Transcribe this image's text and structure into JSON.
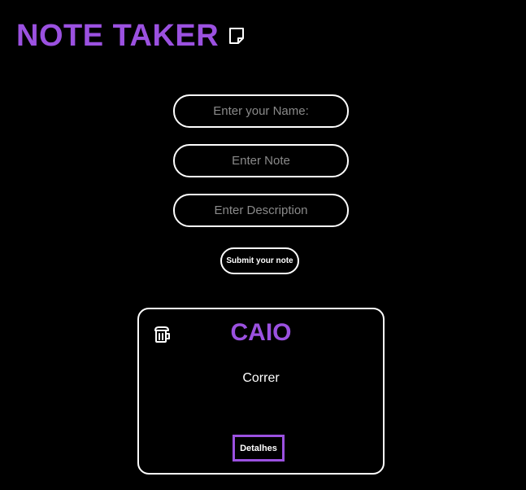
{
  "header": {
    "title": "NOTE TAKER",
    "icon": "note-icon"
  },
  "form": {
    "name_placeholder": "Enter your Name:",
    "note_placeholder": "Enter Note",
    "description_placeholder": "Enter Description",
    "submit_label": "Submit your note"
  },
  "notes": [
    {
      "name": "CAIO",
      "note": "Correr",
      "details_label": "Detalhes",
      "delete_icon": "trash-icon"
    }
  ],
  "colors": {
    "background": "#000000",
    "accent": "#9b51e0",
    "text": "#ffffff",
    "placeholder": "#8a8a8a"
  }
}
